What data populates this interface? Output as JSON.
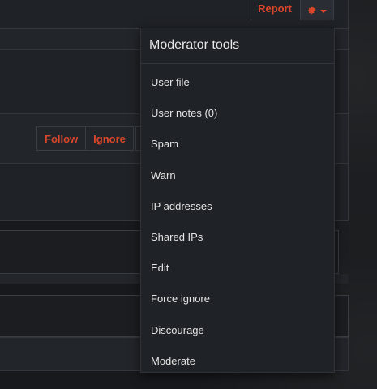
{
  "header": {
    "report_label": "Report",
    "gear_icon": "gear-icon"
  },
  "profile_actions": {
    "follow_label": "Follow",
    "ignore_label": "Ignore"
  },
  "moderator_menu": {
    "title": "Moderator tools",
    "items": [
      {
        "label": "User file"
      },
      {
        "label": "User notes (0)"
      },
      {
        "label": "Spam"
      },
      {
        "label": "Warn"
      },
      {
        "label": "IP addresses"
      },
      {
        "label": "Shared IPs"
      },
      {
        "label": "Edit"
      },
      {
        "label": "Force ignore"
      },
      {
        "label": "Discourage"
      },
      {
        "label": "Moderate"
      }
    ]
  },
  "colors": {
    "accent": "#d9462a",
    "menu_bg": "#1f2226",
    "page_bg": "#17191c"
  }
}
